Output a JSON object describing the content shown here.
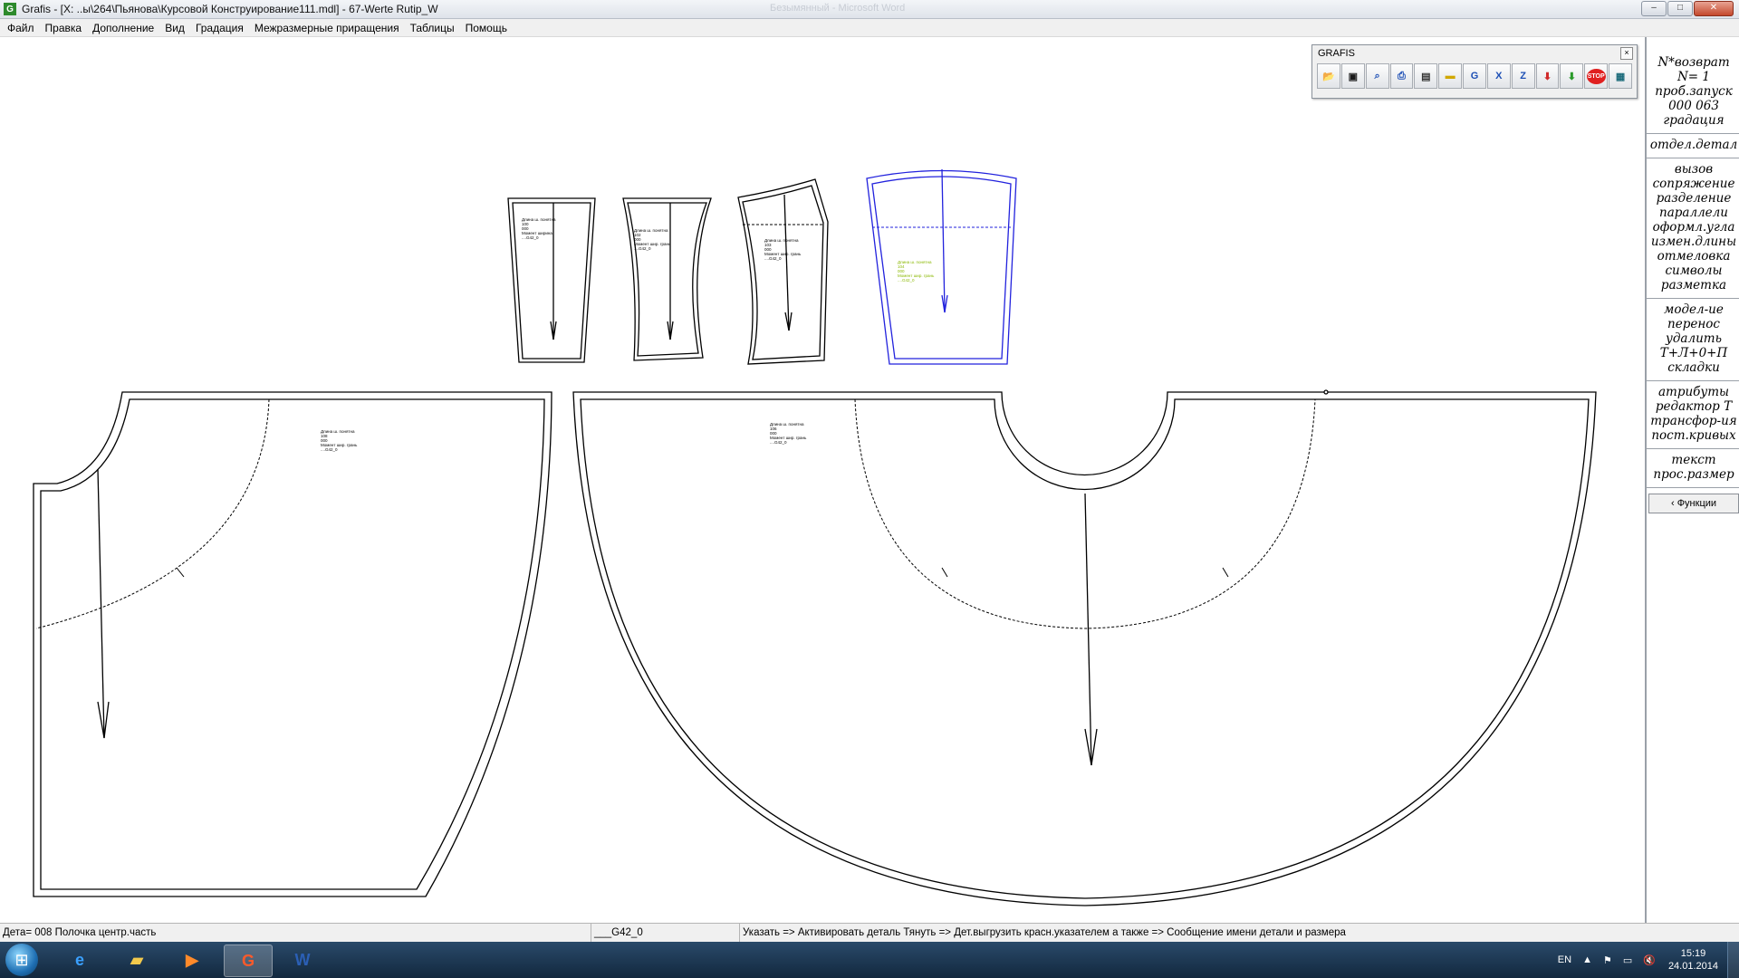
{
  "window": {
    "app_icon": "G",
    "title": "Grafis - [X: ..ы\\264\\Пьянова\\Курсовой Конструирование111.mdl] - 67-Werte Rutip_W",
    "background_title": "Безымянный - Microsoft Word",
    "controls": {
      "minimize": "–",
      "maximize": "□",
      "close": "✕"
    }
  },
  "menu": [
    "Файл",
    "Правка",
    "Дополнение",
    "Вид",
    "Градация",
    "Межразмерные приращения",
    "Таблицы",
    "Помощь"
  ],
  "toolbar": {
    "title": "GRAFIS",
    "close": "×",
    "buttons": [
      {
        "name": "open-folder-icon",
        "glyph": "📂",
        "color": "#c98a00"
      },
      {
        "name": "save-disk-icon",
        "glyph": "▣",
        "color": "#1a1a1a"
      },
      {
        "name": "zoom-magnifier-icon",
        "glyph": "⌕",
        "color": "#1d4fb5"
      },
      {
        "name": "print-icon",
        "glyph": "⎙",
        "color": "#1d4fb5"
      },
      {
        "name": "layout-sheet-icon",
        "glyph": "▤",
        "color": "#333333"
      },
      {
        "name": "ruler-measure-icon",
        "glyph": "▬",
        "color": "#d1a800"
      },
      {
        "name": "grading-g-icon",
        "glyph": "G",
        "color": "#1d4fb5"
      },
      {
        "name": "x-axis-icon",
        "glyph": "X",
        "color": "#1d4fb5"
      },
      {
        "name": "z-axis-icon",
        "glyph": "Z",
        "color": "#1d4fb5"
      },
      {
        "name": "download-arrow-icon",
        "glyph": "⬇",
        "color": "#d02a2a"
      },
      {
        "name": "download-arrow-green-icon",
        "glyph": "⬇",
        "color": "#2a9a2a"
      },
      {
        "name": "stop-icon",
        "glyph": "STOP",
        "color": "#e02020"
      },
      {
        "name": "screen-monitor-icon",
        "glyph": "▦",
        "color": "#1a6a7a"
      }
    ]
  },
  "right_panel": {
    "groups": [
      [
        "N*возврат",
        "N=  1",
        "проб.запуск",
        "000 063",
        "градация"
      ],
      [
        "отдел.детал"
      ],
      [
        "вызов",
        "сопряжение",
        "разделение",
        "параллели",
        "оформл.угла",
        "измен.длины",
        "отмеловка",
        "символы",
        "разметка"
      ],
      [
        "модел-ие",
        "перенос",
        "удалить",
        "Т+Л+0+П",
        "складки"
      ],
      [
        "атрибуты",
        "редактор Т",
        "трансфор-ия",
        "пост.кривых"
      ],
      [
        "текст",
        "прос.размер"
      ]
    ],
    "functions_button": "‹ Функции"
  },
  "canvas": {
    "piece_labels": [
      [
        "Длина ш. понятна",
        "100",
        "000",
        "Момент ширина",
        "....G42_0"
      ],
      [
        "Длина ш. понятна",
        "102",
        "000",
        "Момент шир. грань",
        "....G42_0"
      ],
      [
        "Длина ш. понятна",
        "103",
        "000",
        "Момент шир. грань",
        "....G42_0"
      ],
      [
        "Длина ш. понятна",
        "104",
        "000",
        "Момент шир. грань",
        "....G42_0"
      ],
      [
        "Длина ш. понятна",
        "108",
        "000",
        "Момент шир. грань",
        "....G42_0"
      ],
      [
        "Длина ш. понятна",
        "106",
        "000",
        "Момент шир. грань",
        "....G42_0"
      ]
    ],
    "line_color": "#000000",
    "selected_color": "#2222dd",
    "label_selected_color": "#8ab800"
  },
  "status": {
    "detail": "Дета= 008  Полочка центр.часть",
    "size": "___G42_0",
    "hint": "Указать => Активировать деталь Тянуть => Дет.выгрузить красн.указателем а также => Сообщение имени детали и размера"
  },
  "taskbar": {
    "start": "⊞",
    "apps": [
      {
        "name": "internet-explorer-icon",
        "glyph": "e",
        "color": "#3aa0ff"
      },
      {
        "name": "file-explorer-icon",
        "glyph": "▰",
        "color": "#f2c94c"
      },
      {
        "name": "media-player-icon",
        "glyph": "▶",
        "color": "#ff8a2a"
      },
      {
        "name": "grafis-app-icon",
        "glyph": "G",
        "color": "#ff5a2a",
        "active": true
      },
      {
        "name": "word-icon",
        "glyph": "W",
        "color": "#2b5fb5"
      }
    ],
    "lang": "EN",
    "tray_icons": [
      "▲",
      "⚑",
      "▭",
      "🔇"
    ],
    "time": "15:19",
    "date": "24.01.2014"
  }
}
